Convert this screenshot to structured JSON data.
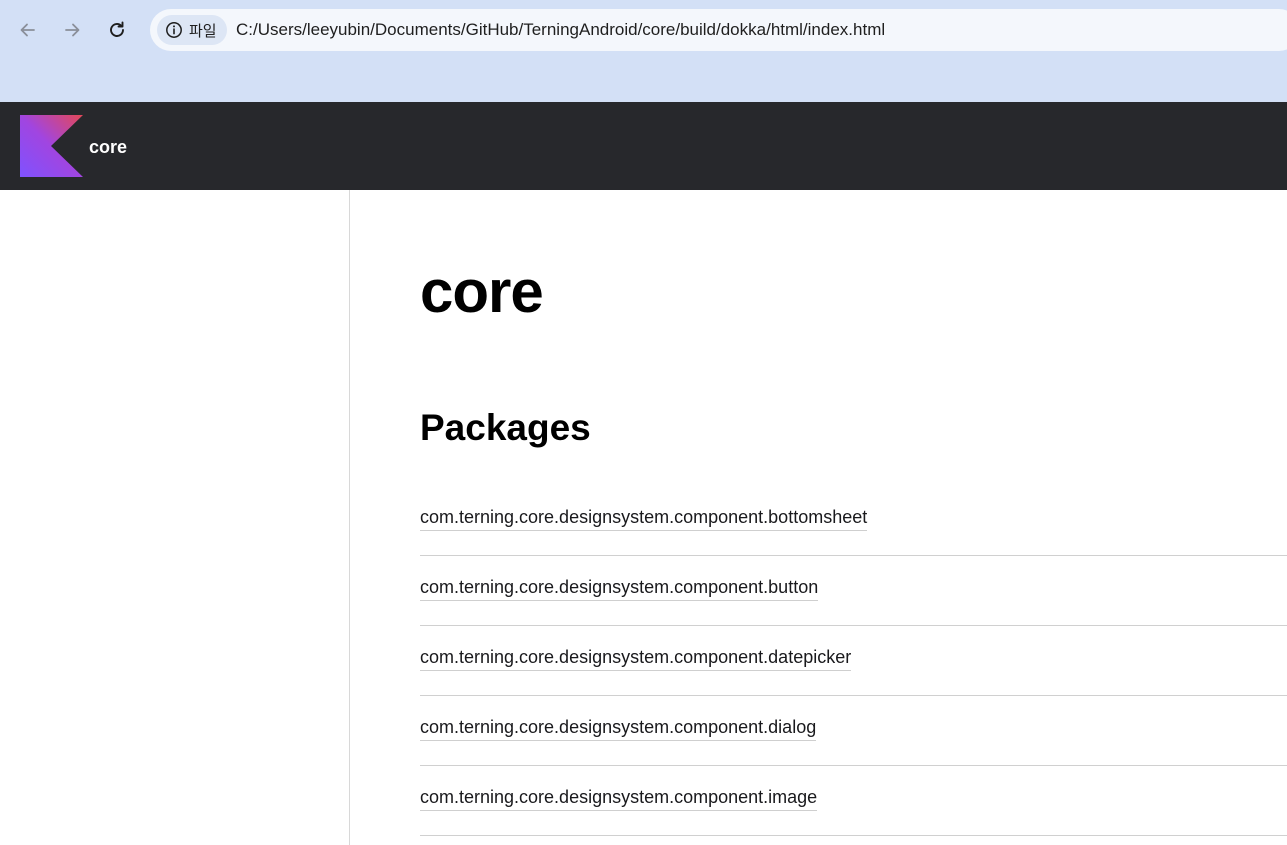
{
  "browser": {
    "site_chip_label": "파일",
    "url": "C:/Users/leeyubin/Documents/GitHub/TerningAndroid/core/build/dokka/html/index.html",
    "icons": {
      "back": "arrow-left-icon",
      "forward": "arrow-right-icon",
      "reload": "reload-icon",
      "info": "info-icon"
    }
  },
  "header": {
    "title": "core",
    "logo": "kotlin-logo",
    "background": "#27282c"
  },
  "main": {
    "title": "core",
    "packages_heading": "Packages",
    "packages": [
      "com.terning.core.designsystem.component.bottomsheet",
      "com.terning.core.designsystem.component.button",
      "com.terning.core.designsystem.component.datepicker",
      "com.terning.core.designsystem.component.dialog",
      "com.terning.core.designsystem.component.image"
    ]
  }
}
